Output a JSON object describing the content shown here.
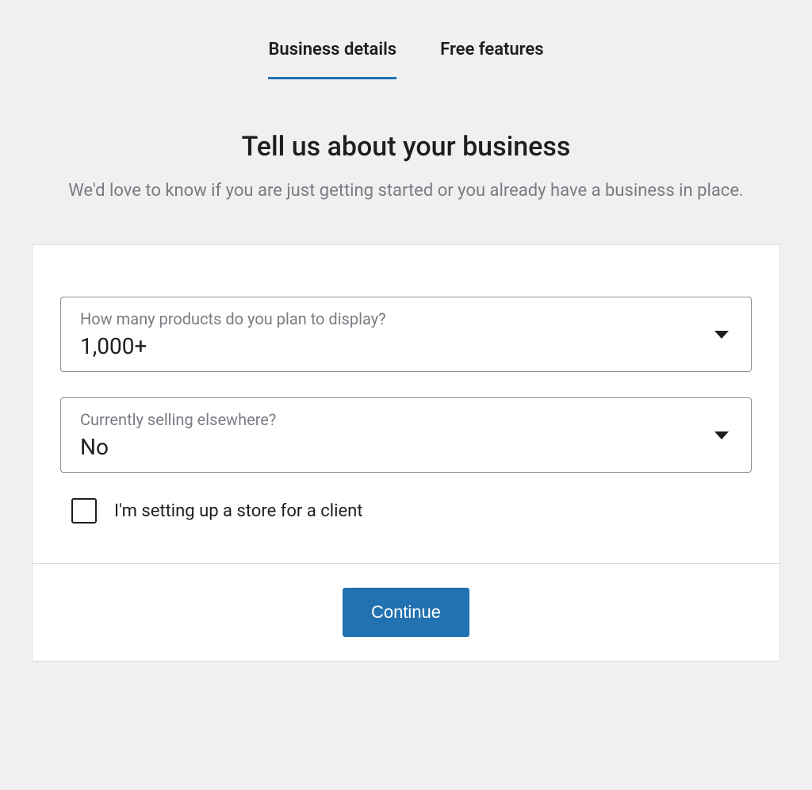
{
  "tabs": {
    "business_details": "Business details",
    "free_features": "Free features"
  },
  "heading": {
    "title": "Tell us about your business",
    "subtitle": "We'd love to know if you are just getting started or you already have a business in place."
  },
  "form": {
    "products_select": {
      "label": "How many products do you plan to display?",
      "value": "1,000+"
    },
    "selling_select": {
      "label": "Currently selling elsewhere?",
      "value": "No"
    },
    "client_checkbox": {
      "label": "I'm setting up a store for a client",
      "checked": false
    }
  },
  "footer": {
    "continue_label": "Continue"
  }
}
